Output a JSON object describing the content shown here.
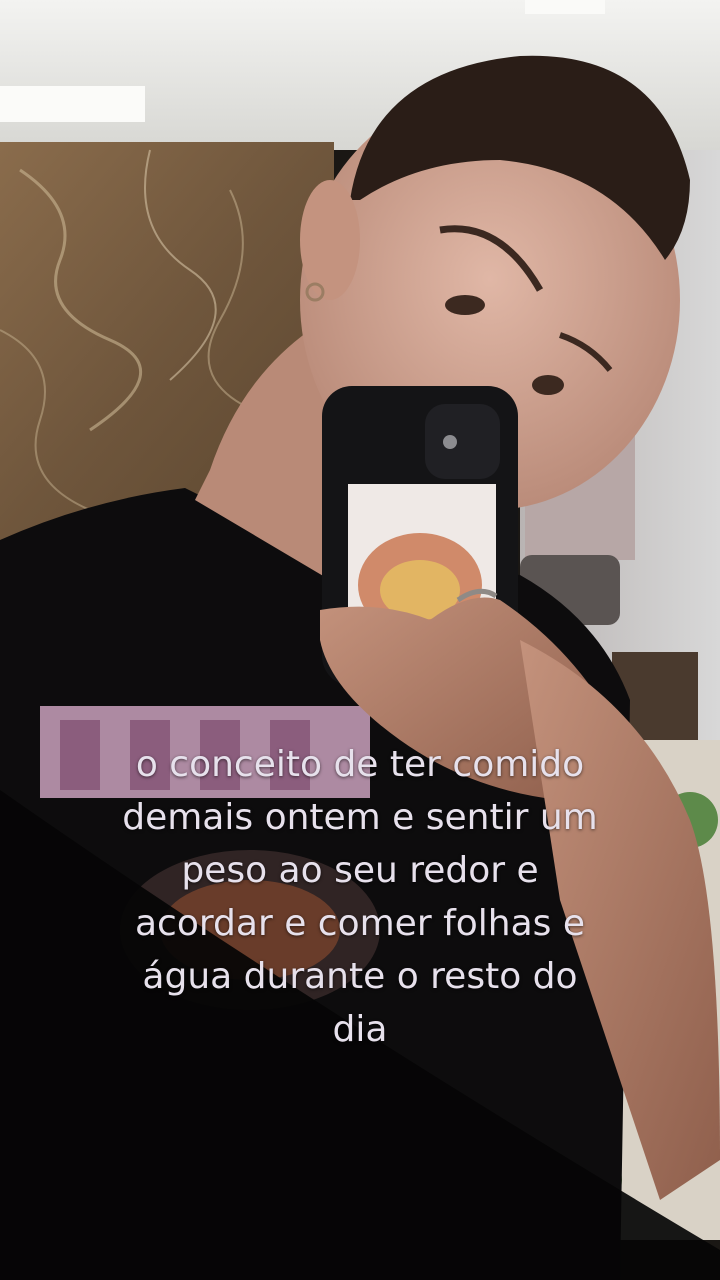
{
  "caption": {
    "lines": [
      "o conceito de ter comido",
      "demais ontem e sentir um",
      "peso ao seu redor e",
      "acordar e comer folhas e",
      "água durante o resto do",
      "dia"
    ]
  },
  "colors": {
    "ceiling": "#e9e9e6",
    "marble": "#7a6146",
    "shirt": "#0d0c0d",
    "skin": "#c9a08e",
    "phone": "#141416",
    "caption_text": "#e7e1ec"
  }
}
